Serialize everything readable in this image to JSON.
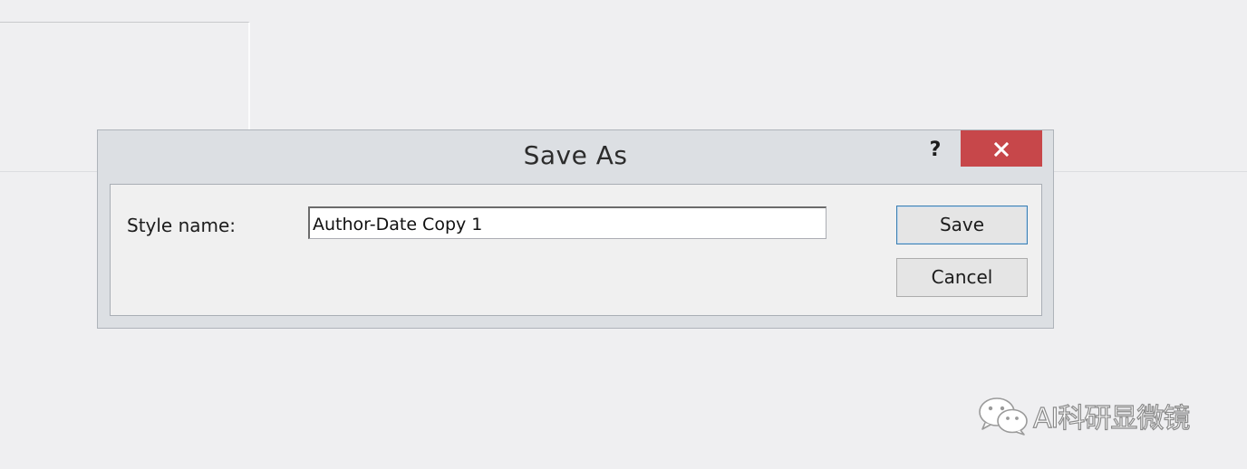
{
  "dialog": {
    "title": "Save As",
    "help_label": "?",
    "style_name_label": "Style name:",
    "style_name_value": "Author-Date Copy 1",
    "save_label": "Save",
    "cancel_label": "Cancel"
  },
  "icons": {
    "close": "close-icon",
    "watermark": "wechat-icon"
  },
  "colors": {
    "close_button": "#c7474a",
    "dialog_frame": "#dcdfe3",
    "default_button_border": "#3c7fb1"
  },
  "watermark": {
    "text": "AI科研显微镜"
  }
}
